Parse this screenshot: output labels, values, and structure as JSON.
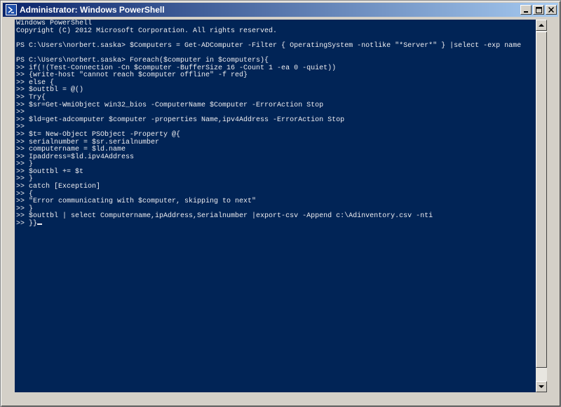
{
  "window": {
    "title": "Administrator: Windows PowerShell",
    "icon": "powershell-icon"
  },
  "title_buttons": {
    "minimize_icon": "minimize-icon",
    "maximize_icon": "maximize-icon",
    "close_icon": "close-icon"
  },
  "console": {
    "background": "#012456",
    "foreground": "#eeedf0",
    "lines": [
      "Windows PowerShell",
      "Copyright (C) 2012 Microsoft Corporation. All rights reserved.",
      "",
      "PS C:\\Users\\norbert.saska> $Computers = Get-ADComputer -Filter { OperatingSystem -notlike \"*Server*\" } |select -exp name",
      "",
      "PS C:\\Users\\norbert.saska> Foreach($computer in $computers){",
      ">> if(!(Test-Connection -Cn $computer -BufferSize 16 -Count 1 -ea 0 -quiet))",
      ">> {write-host \"cannot reach $computer offline\" -f red}",
      ">> else {",
      ">> $outtbl = @()",
      ">> Try{",
      ">> $sr=Get-WmiObject win32_bios -ComputerName $Computer -ErrorAction Stop",
      ">>",
      ">> $ld=get-adcomputer $computer -properties Name,ipv4Address -ErrorAction Stop",
      ">>",
      ">> $t= New-Object PSObject -Property @{",
      ">> serialnumber = $sr.serialnumber",
      ">> computername = $ld.name",
      ">> Ipaddress=$ld.ipv4Address",
      ">> }",
      ">> $outtbl += $t",
      ">> }",
      ">> catch [Exception]",
      ">> {",
      ">> \"Error communicating with $computer, skipping to next\"",
      ">> }",
      ">> $outtbl | select Computername,ipAddress,Serialnumber |export-csv -Append c:\\Adinventory.csv -nti",
      ">> }}"
    ]
  },
  "scrollbar": {
    "up_icon": "scroll-up-icon",
    "down_icon": "scroll-down-icon"
  }
}
